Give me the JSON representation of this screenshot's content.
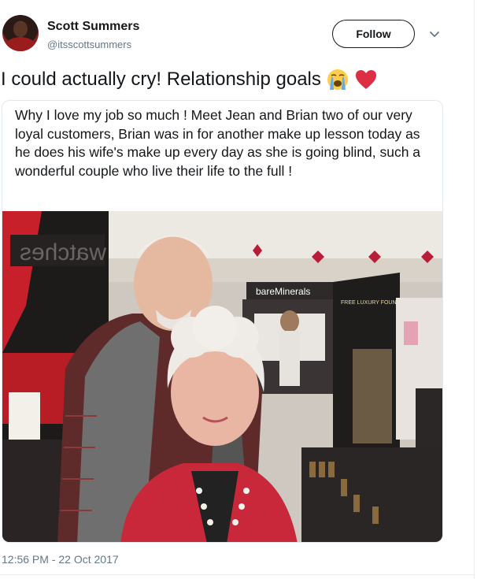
{
  "user": {
    "name": "Scott Summers",
    "handle": "@itsscottsummers"
  },
  "follow_button": {
    "label": "Follow"
  },
  "tweet": {
    "text": "I could actually cry! Relationship goals",
    "emojis": [
      "loudly-crying-face-icon",
      "red-heart-icon"
    ]
  },
  "quoted_card": {
    "text": "Why I love my job so much ! Meet Jean and Brian two of our very loyal customers, Brian was in for another make up lesson today as he does his wife's make up every day as she is going blind, such a wonderful couple who live their life to the full !",
    "photo": {
      "store_sign": "bareMinerals",
      "side_sign": "watches",
      "promo_sign": "FREE LUXURY FOUNDATION SAMPLE"
    }
  },
  "timestamp": "12:56 PM - 22 Oct 2017",
  "colors": {
    "text": "#14171a",
    "secondary": "#657786",
    "border": "#e1e8ed",
    "heart": "#e0245e"
  }
}
